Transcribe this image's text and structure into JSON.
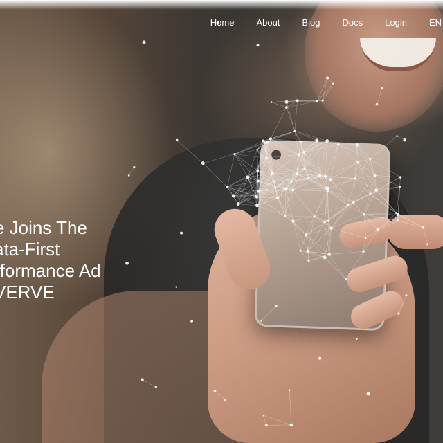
{
  "nav": {
    "items": [
      {
        "label": "Home"
      },
      {
        "label": "About"
      },
      {
        "label": "Blog"
      },
      {
        "label": "Docs"
      },
      {
        "label": "Login"
      },
      {
        "label": "EN"
      }
    ]
  },
  "hero": {
    "headline_lines": [
      "e Joins The",
      "ata-First",
      "rformance Ad",
      "VERVE"
    ],
    "text_color": "#ffffff"
  }
}
